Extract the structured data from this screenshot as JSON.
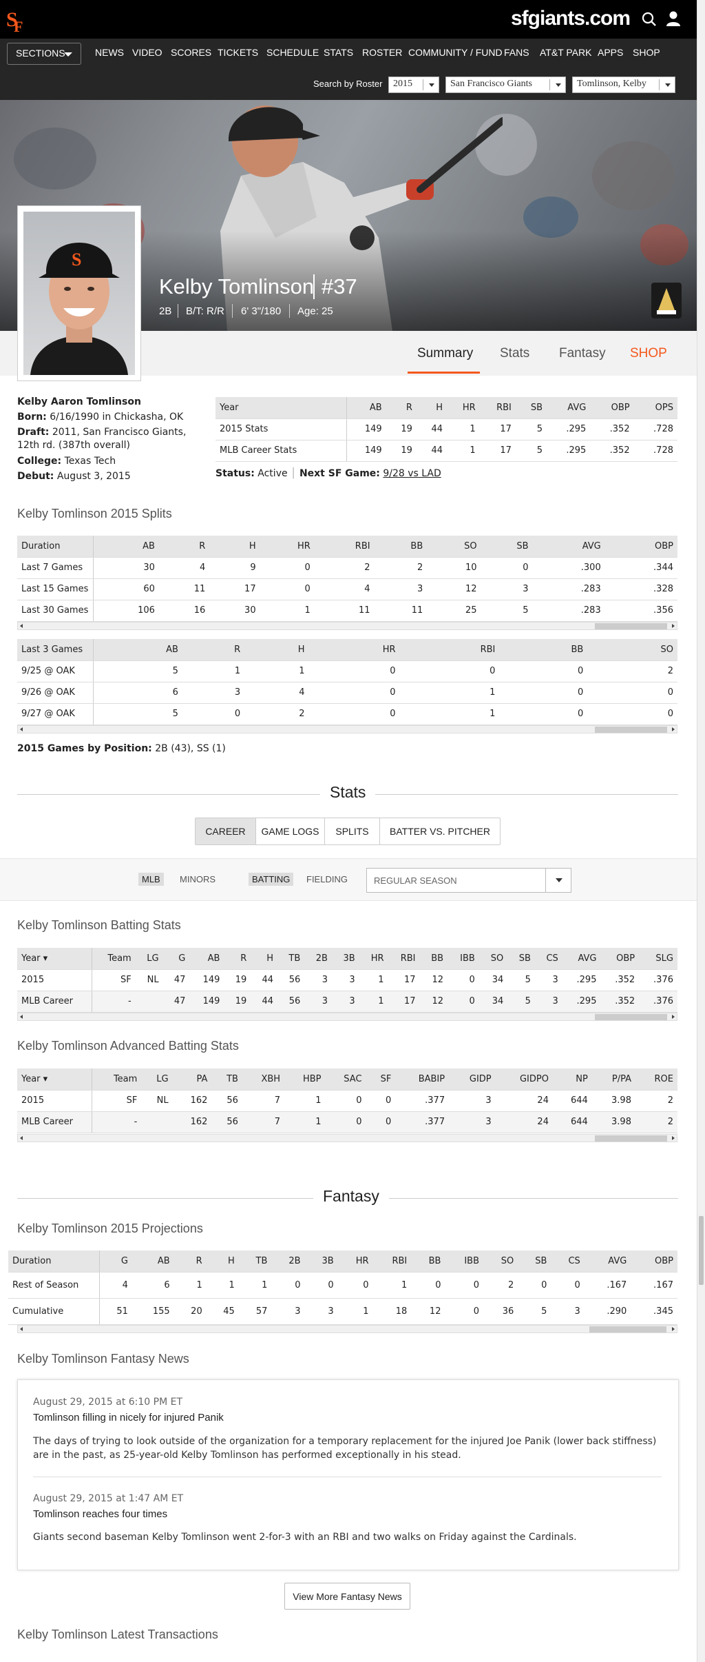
{
  "header": {
    "site_title": "sfgiants.com",
    "sections_label": "SECTIONS",
    "nav": [
      "NEWS",
      "VIDEO",
      "SCORES",
      "TICKETS",
      "SCHEDULE",
      "STATS",
      "ROSTER",
      "COMMUNITY / FUND",
      "FANS",
      "AT&T PARK",
      "APPS",
      "SHOP"
    ]
  },
  "roster_search": {
    "label": "Search by Roster",
    "year": "2015",
    "team": "San Francisco Giants",
    "player": "Tomlinson, Kelby"
  },
  "player": {
    "name": "Kelby Tomlinson",
    "number": "#37",
    "position": "2B",
    "bt": "B/T: R/R",
    "height_weight": "6' 3\"/180",
    "age": "Age: 25"
  },
  "profile_tabs": [
    "Summary",
    "Stats",
    "Fantasy",
    "SHOP"
  ],
  "bio": {
    "full_name": "Kelby Aaron Tomlinson",
    "born_label": "Born:",
    "born": "6/16/1990 in Chickasha, OK",
    "draft_label": "Draft:",
    "draft_line1": "2011, San Francisco Giants,",
    "draft_line2": "12th rd. (387th overall)",
    "college_label": "College:",
    "college": "Texas Tech",
    "debut_label": "Debut:",
    "debut": "August 3, 2015"
  },
  "summary_table": {
    "headers": [
      "Year",
      "AB",
      "R",
      "H",
      "HR",
      "RBI",
      "SB",
      "AVG",
      "OBP",
      "OPS"
    ],
    "rows": [
      [
        "2015 Stats",
        "149",
        "19",
        "44",
        "1",
        "17",
        "5",
        ".295",
        ".352",
        ".728"
      ],
      [
        "MLB Career Stats",
        "149",
        "19",
        "44",
        "1",
        "17",
        "5",
        ".295",
        ".352",
        ".728"
      ]
    ]
  },
  "status": {
    "status_label": "Status:",
    "status": "Active",
    "next_label": "Next SF Game:",
    "next_game": "9/28 vs LAD"
  },
  "splits": {
    "title": "Kelby Tomlinson 2015 Splits",
    "duration_headers": [
      "Duration",
      "AB",
      "R",
      "H",
      "HR",
      "RBI",
      "BB",
      "SO",
      "SB",
      "AVG",
      "OBP"
    ],
    "duration_rows": [
      [
        "Last 7 Games",
        "30",
        "4",
        "9",
        "0",
        "2",
        "2",
        "10",
        "0",
        ".300",
        ".344"
      ],
      [
        "Last 15 Games",
        "60",
        "11",
        "17",
        "0",
        "4",
        "3",
        "12",
        "3",
        ".283",
        ".328"
      ],
      [
        "Last 30 Games",
        "106",
        "16",
        "30",
        "1",
        "11",
        "11",
        "25",
        "5",
        ".283",
        ".356"
      ]
    ],
    "games_headers": [
      "Last 3 Games",
      "AB",
      "R",
      "H",
      "HR",
      "RBI",
      "BB",
      "SO"
    ],
    "games_rows": [
      [
        "9/25 @ OAK",
        "5",
        "1",
        "1",
        "0",
        "0",
        "0",
        "2"
      ],
      [
        "9/26 @ OAK",
        "6",
        "3",
        "4",
        "0",
        "1",
        "0",
        "0"
      ],
      [
        "9/27 @ OAK",
        "5",
        "0",
        "2",
        "0",
        "1",
        "0",
        "0"
      ]
    ],
    "by_position_label": "2015 Games by Position:",
    "by_position": "2B (43), SS (1)"
  },
  "stats_section": {
    "heading": "Stats",
    "tabs": [
      "CAREER",
      "GAME LOGS",
      "SPLITS",
      "BATTER VS. PITCHER"
    ],
    "filters": [
      "MLB",
      "MINORS",
      "BATTING",
      "FIELDING"
    ],
    "season_select": "REGULAR SEASON"
  },
  "batting": {
    "title": "Kelby Tomlinson Batting Stats",
    "headers": [
      "Year",
      "Team",
      "LG",
      "G",
      "AB",
      "R",
      "H",
      "TB",
      "2B",
      "3B",
      "HR",
      "RBI",
      "BB",
      "IBB",
      "SO",
      "SB",
      "CS",
      "AVG",
      "OBP",
      "SLG"
    ],
    "rows": [
      [
        "2015",
        "SF",
        "NL",
        "47",
        "149",
        "19",
        "44",
        "56",
        "3",
        "3",
        "1",
        "17",
        "12",
        "0",
        "34",
        "5",
        "3",
        ".295",
        ".352",
        ".376"
      ],
      [
        "MLB Career",
        "-",
        "",
        "47",
        "149",
        "19",
        "44",
        "56",
        "3",
        "3",
        "1",
        "17",
        "12",
        "0",
        "34",
        "5",
        "3",
        ".295",
        ".352",
        ".376"
      ]
    ]
  },
  "advanced": {
    "title": "Kelby Tomlinson Advanced Batting Stats",
    "headers": [
      "Year",
      "Team",
      "LG",
      "PA",
      "TB",
      "XBH",
      "HBP",
      "SAC",
      "SF",
      "BABIP",
      "GIDP",
      "GIDPO",
      "NP",
      "P/PA",
      "ROE"
    ],
    "rows": [
      [
        "2015",
        "SF",
        "NL",
        "162",
        "56",
        "7",
        "1",
        "0",
        "0",
        ".377",
        "3",
        "24",
        "644",
        "3.98",
        "2"
      ],
      [
        "MLB Career",
        "-",
        "",
        "162",
        "56",
        "7",
        "1",
        "0",
        "0",
        ".377",
        "3",
        "24",
        "644",
        "3.98",
        "2"
      ]
    ]
  },
  "fantasy": {
    "heading": "Fantasy",
    "projections_title": "Kelby Tomlinson 2015 Projections",
    "headers": [
      "Duration",
      "G",
      "AB",
      "R",
      "H",
      "TB",
      "2B",
      "3B",
      "HR",
      "RBI",
      "BB",
      "IBB",
      "SO",
      "SB",
      "CS",
      "AVG",
      "OBP"
    ],
    "rows": [
      [
        "Rest of Season",
        "4",
        "6",
        "1",
        "1",
        "1",
        "0",
        "0",
        "0",
        "1",
        "0",
        "0",
        "2",
        "0",
        "0",
        ".167",
        ".167"
      ],
      [
        "Cumulative",
        "51",
        "155",
        "20",
        "45",
        "57",
        "3",
        "3",
        "1",
        "18",
        "12",
        "0",
        "36",
        "5",
        "3",
        ".290",
        ".345"
      ]
    ],
    "news_title": "Kelby Tomlinson Fantasy News",
    "news": [
      {
        "date": "August 29, 2015 at 6:10 PM ET",
        "headline": "Tomlinson filling in nicely for injured Panik",
        "body": "The days of trying to look outside of the organization for a temporary replacement for the injured Joe Panik (lower back stiffness) are in the past, as 25-year-old Kelby Tomlinson has performed exceptionally in his stead."
      },
      {
        "date": "August 29, 2015 at 1:47 AM ET",
        "headline": "Tomlinson reaches four times",
        "body": "Giants second baseman Kelby Tomlinson went 2-for-3 with an RBI and two walks on Friday against the Cardinals."
      }
    ],
    "more_news_label": "View More Fantasy News"
  },
  "transactions": {
    "title": "Kelby Tomlinson Latest Transactions"
  },
  "colors": {
    "accent": "#f4581c",
    "header_bg": "#000000",
    "nav_bg": "#262626",
    "table_header_bg": "#e6e6e6"
  }
}
